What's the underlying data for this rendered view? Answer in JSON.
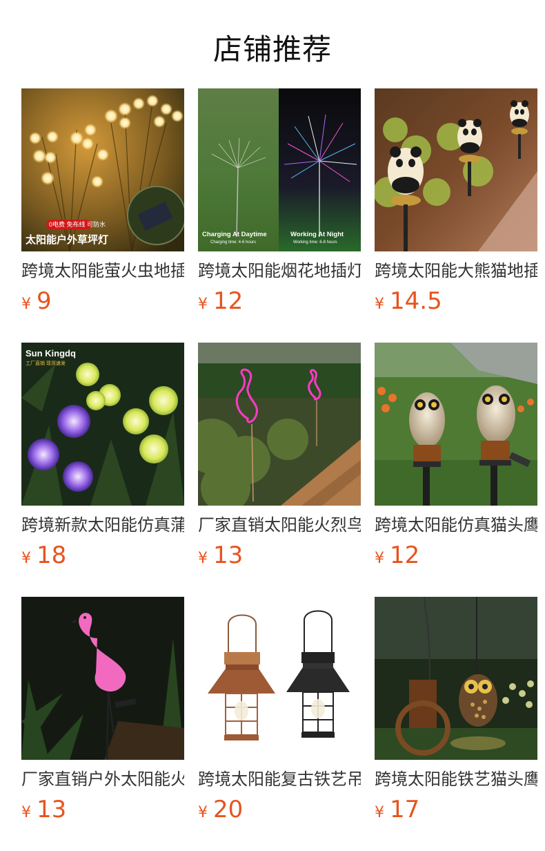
{
  "section_title": "店铺推荐",
  "currency_symbol": "¥",
  "accent_color": "#e8531e",
  "products": [
    {
      "name": "跨境太阳能萤火虫地插灯",
      "price": "9",
      "image_badge": "0电费 免布线 可防水",
      "image_caption": "太阳能户外草坪灯"
    },
    {
      "name": "跨境太阳能烟花地插灯",
      "price": "12",
      "image_caption_left": "Charging At Daytime",
      "image_sub_left": "Charging time: 4-6 hours",
      "image_caption_right": "Working At Night",
      "image_sub_right": "Working time: 6-8 hours"
    },
    {
      "name": "跨境太阳能大熊猫地插灯",
      "price": "14.5"
    },
    {
      "name": "跨境新款太阳能仿真蒲公英灯",
      "price": "18",
      "image_brand": "Sun Kingdq",
      "image_brand_sub": "工厂直销  现货速发"
    },
    {
      "name": "厂家直销太阳能火烈鸟灯",
      "price": "13"
    },
    {
      "name": "跨境太阳能仿真猫头鹰灯",
      "price": "12"
    },
    {
      "name": "厂家直销户外太阳能火烈鸟灯",
      "price": "13"
    },
    {
      "name": "跨境太阳能复古铁艺吊灯",
      "price": "20"
    },
    {
      "name": "跨境太阳能铁艺猫头鹰灯",
      "price": "17"
    }
  ]
}
